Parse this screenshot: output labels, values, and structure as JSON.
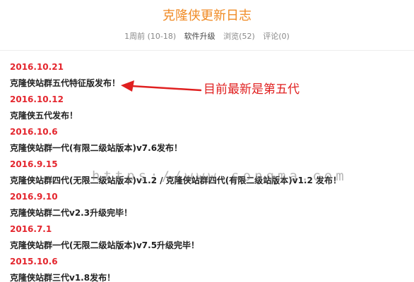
{
  "article": {
    "title": "克隆侠更新日志",
    "meta": {
      "date": "1周前 (10-18)",
      "category": "软件升级",
      "views": "浏览(52)",
      "comments": "评论(0)"
    }
  },
  "entries": [
    {
      "date": "2016.10.21",
      "text": "克隆侠站群五代特征版发布！"
    },
    {
      "date": "2016.10.12",
      "text": "克隆侠五代发布！"
    },
    {
      "date": "2016.10.6",
      "text": "克隆侠站群一代(有限二级站版本)v7.6发布！"
    },
    {
      "date": "2016.9.15",
      "text": "克隆侠站群四代(无限二级站版本)v1.2 / 克隆侠站群四代(有限二级站版本)v1.2 发布！"
    },
    {
      "date": "2016.9.10",
      "text": "克隆侠站群二代v2.3升级完毕！"
    },
    {
      "date": "2016.7.1",
      "text": "克隆侠站群一代(无限二级站版本)v7.5升级完毕！"
    },
    {
      "date": "2015.10.6",
      "text": "克隆侠站群三代v1.8发布！"
    }
  ],
  "annotation": {
    "text": "目前最新是第五代",
    "color": "#e02020"
  },
  "watermark": "https://www.songma.com",
  "colors": {
    "title": "#f08a24",
    "date": "#e4262e",
    "body_text": "#222222"
  }
}
